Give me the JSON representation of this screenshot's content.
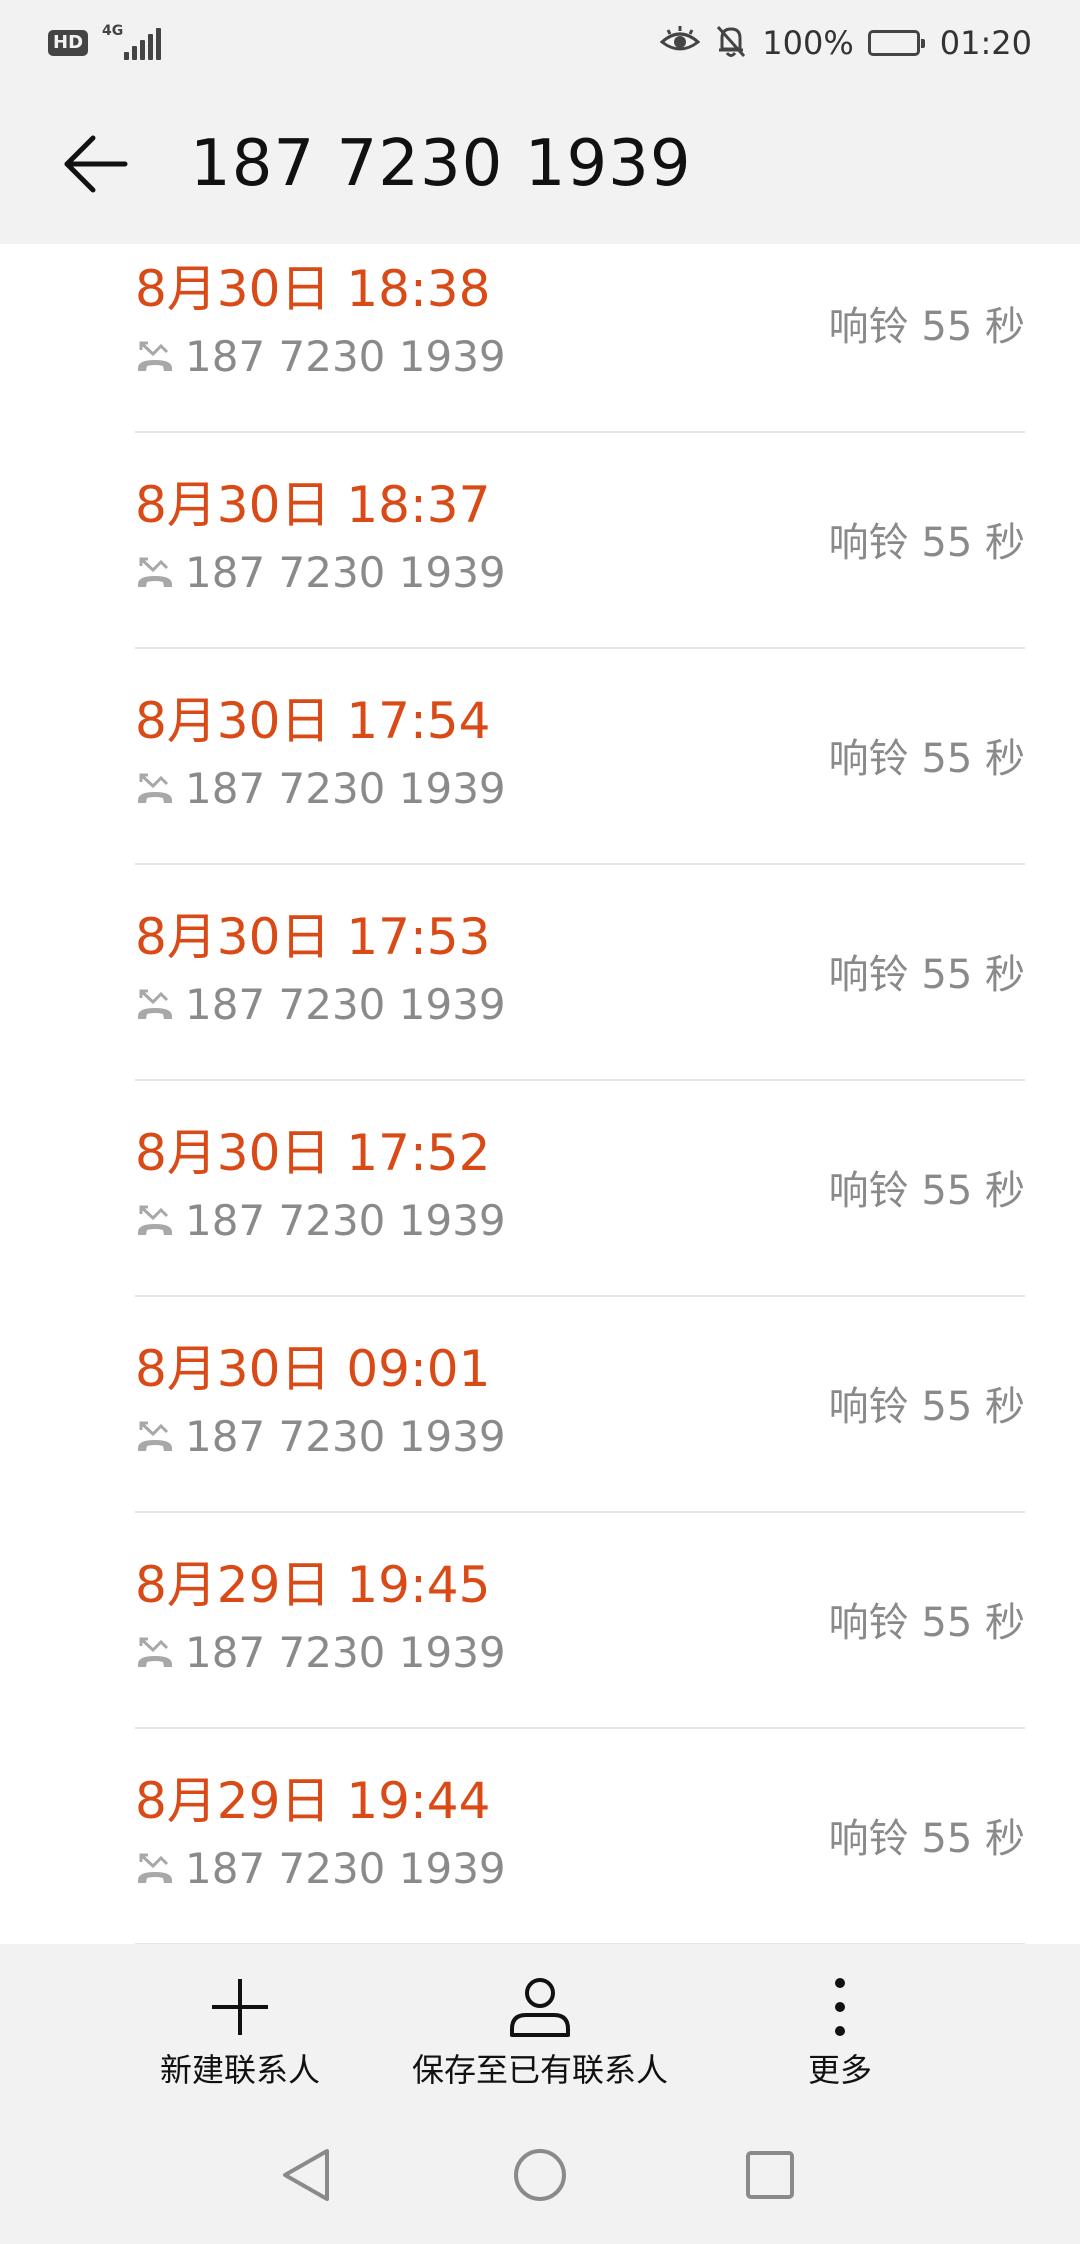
{
  "status_bar": {
    "hd_label": "HD",
    "network_label": "4G",
    "battery_text": "100%",
    "time": "01:20",
    "icons": [
      "hd-icon",
      "signal-icon",
      "eye-comfort-icon",
      "bell-muted-icon",
      "battery-icon"
    ]
  },
  "header": {
    "title": "187 7230 1939",
    "back_icon": "arrow-left-icon"
  },
  "calls": [
    {
      "time": "8月30日 18:38",
      "number": "187 7230 1939",
      "duration": "响铃 55 秒"
    },
    {
      "time": "8月30日 18:37",
      "number": "187 7230 1939",
      "duration": "响铃 55 秒"
    },
    {
      "time": "8月30日 17:54",
      "number": "187 7230 1939",
      "duration": "响铃 55 秒"
    },
    {
      "time": "8月30日 17:53",
      "number": "187 7230 1939",
      "duration": "响铃 55 秒"
    },
    {
      "time": "8月30日 17:52",
      "number": "187 7230 1939",
      "duration": "响铃 55 秒"
    },
    {
      "time": "8月30日 09:01",
      "number": "187 7230 1939",
      "duration": "响铃 55 秒"
    },
    {
      "time": "8月29日 19:45",
      "number": "187 7230 1939",
      "duration": "响铃 55 秒"
    },
    {
      "time": "8月29日 19:44",
      "number": "187 7230 1939",
      "duration": "响铃 55 秒"
    }
  ],
  "actions": {
    "new_contact": "新建联系人",
    "save_existing": "保存至已有联系人",
    "more": "更多"
  },
  "colors": {
    "missed_call_red": "#d94a16",
    "secondary_gray": "#8a8a8a",
    "bar_background": "#f2f2f2",
    "divider": "#e6e6e6"
  }
}
